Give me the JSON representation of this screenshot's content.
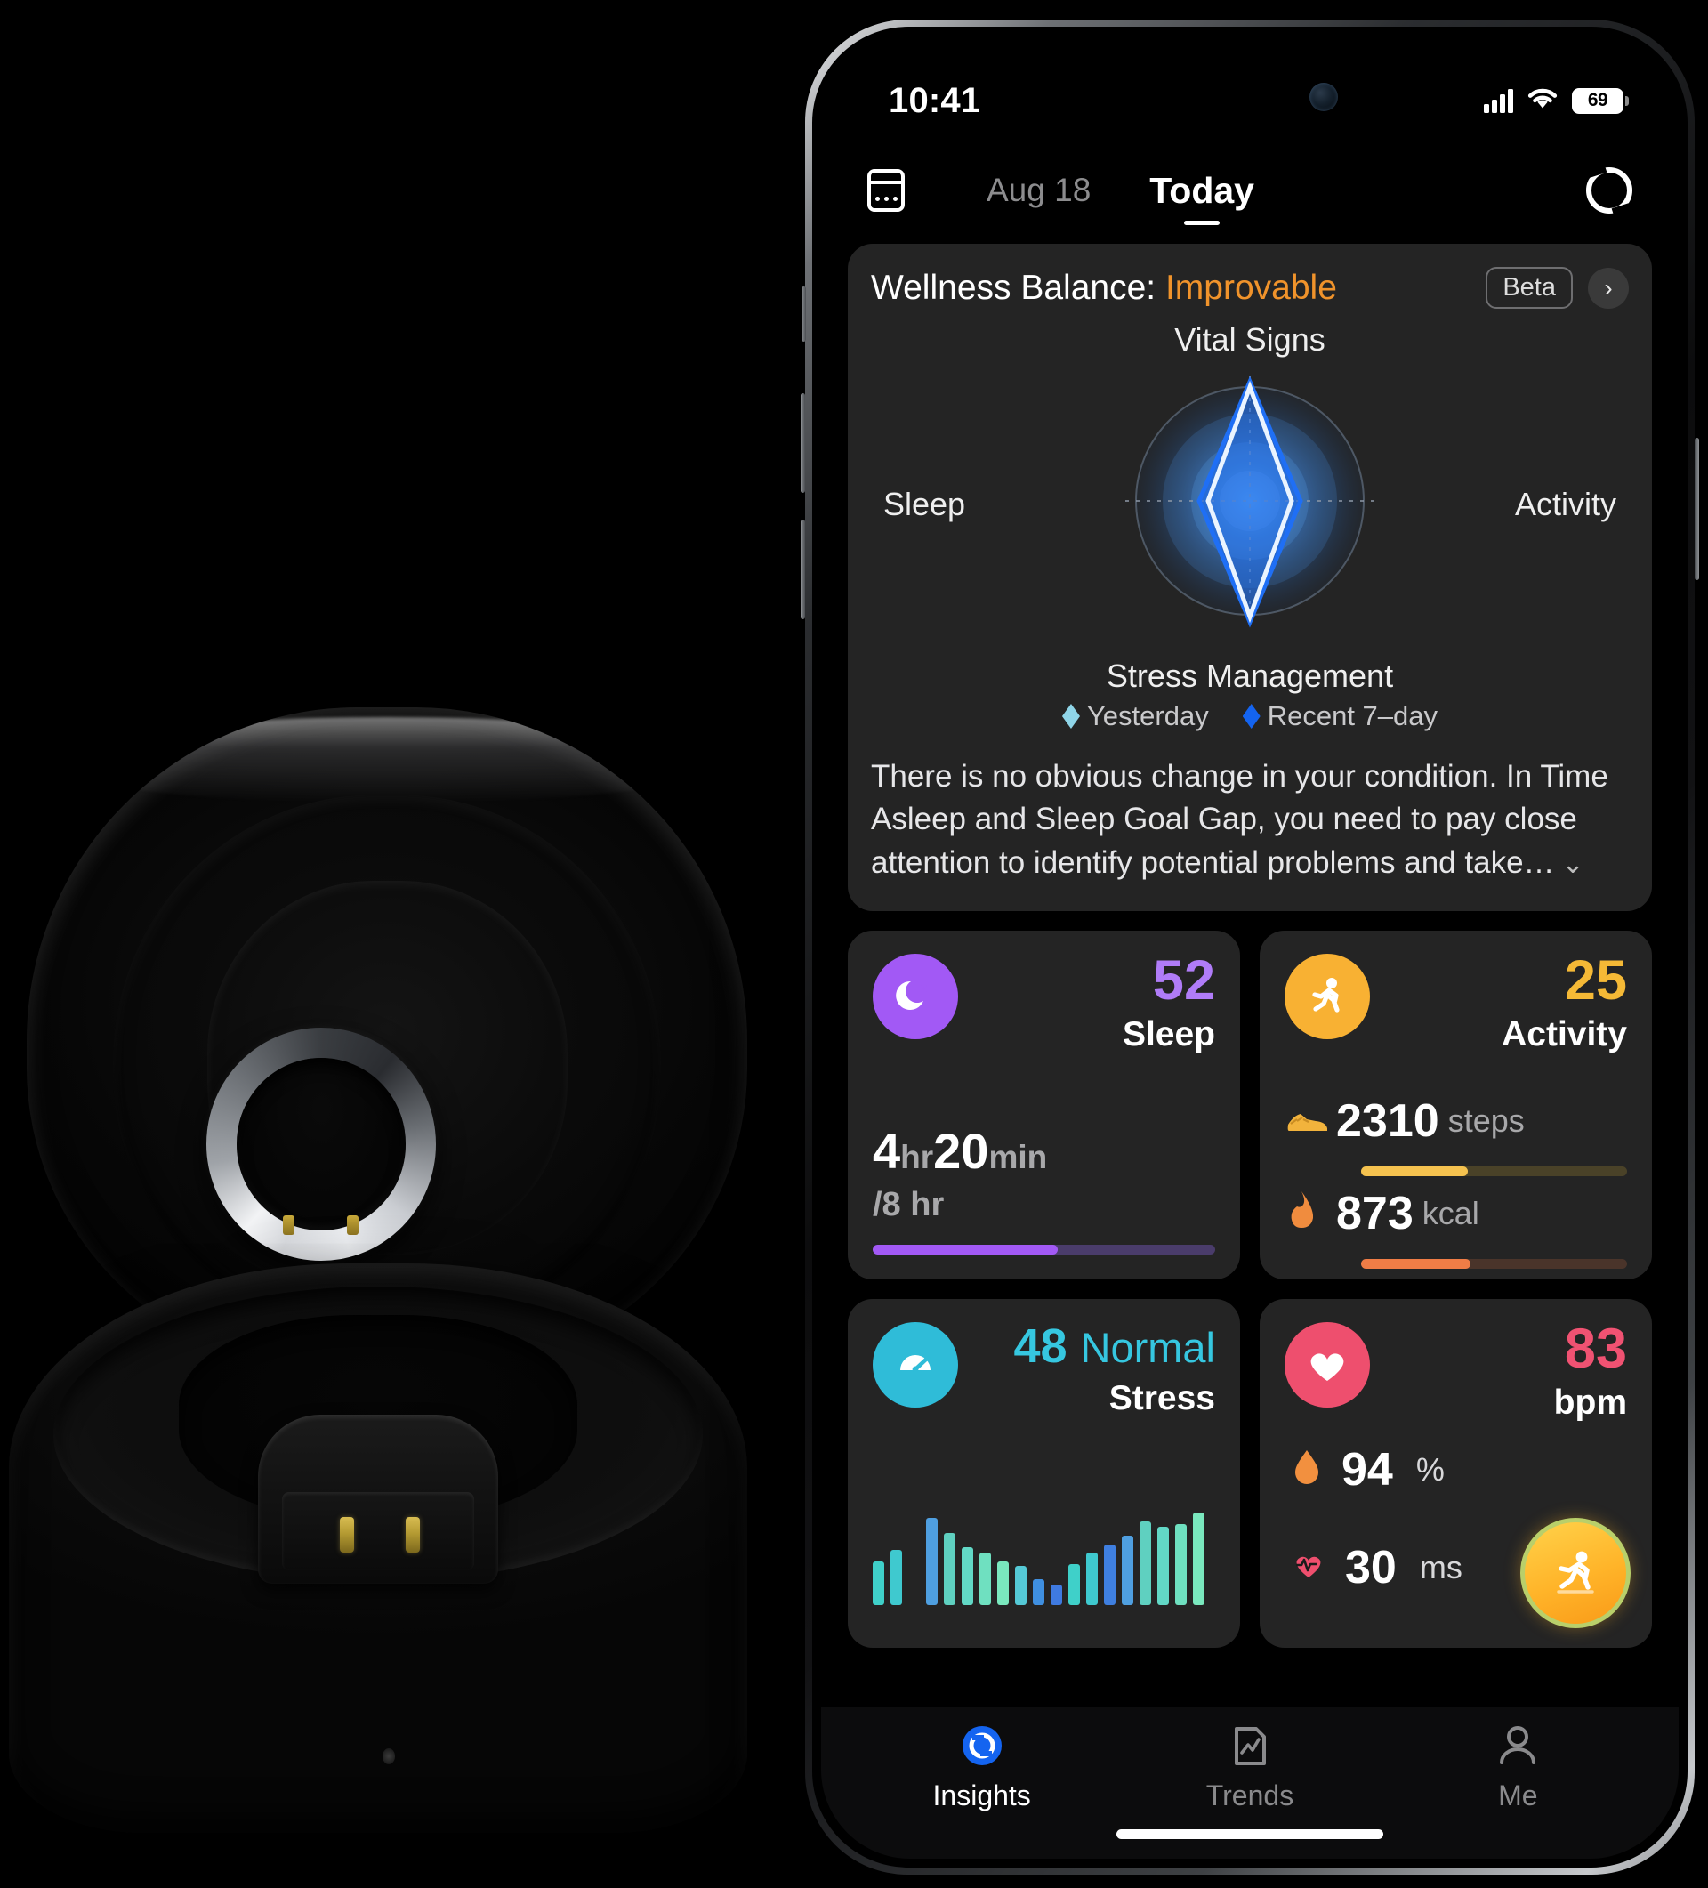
{
  "product": {
    "name": "smart-ring-charging-case",
    "ring_material": "silver-titanium",
    "case_color": "#0a0a0a"
  },
  "phone": {
    "status_bar": {
      "time": "10:41",
      "signal_icon": "cellular-signal-icon",
      "wifi_icon": "wifi-icon",
      "battery_level": "69",
      "battery_icon": "battery-icon"
    },
    "topnav": {
      "calendar_icon": "calendar-icon",
      "date": "Aug 18",
      "today_tab": "Today",
      "sync_icon": "sync-refresh-icon"
    },
    "wellness": {
      "title_prefix": "Wellness Balance:",
      "status": "Improvable",
      "status_color": "#f0932b",
      "beta_label": "Beta",
      "chevron_right": "›",
      "chevron_down": "⌄",
      "description": "There is no obvious change in your condition. In Time Asleep and Sleep Goal Gap, you need to pay close attention to identify potential problems and take…",
      "legend": [
        {
          "label": "Yesterday",
          "color": "#8fd5e8"
        },
        {
          "label": "Recent 7–day",
          "color": "#1464f0"
        }
      ]
    },
    "cards": {
      "sleep": {
        "icon": "sleep-moon-icon",
        "icon_bg": "#a259f5",
        "score": "52",
        "label": "Sleep",
        "score_color": "#b07cf8",
        "hours": "4",
        "hours_unit": "hr",
        "minutes": "20",
        "minutes_unit": "min",
        "goal": "/8 hr",
        "progress_percent": 54,
        "bar_color": "#a259f5"
      },
      "activity": {
        "icon": "running-person-icon",
        "icon_bg": "#f8b133",
        "score": "25",
        "label": "Activity",
        "score_color": "#f5b936",
        "steps_icon": "sneaker-icon",
        "steps_value": "2310",
        "steps_unit": "steps",
        "steps_percent": 40,
        "steps_bar_color": "#f5c24f",
        "kcal_icon": "flame-icon",
        "kcal_value": "873",
        "kcal_unit": "kcal",
        "kcal_percent": 41,
        "kcal_bar_color": "#f07d46"
      },
      "stress": {
        "icon": "stress-gauge-icon",
        "icon_bg": "#2fbcd8",
        "score": "48",
        "state": "Normal",
        "label": "Stress",
        "score_color": "#36c7e0"
      },
      "heart": {
        "icon": "heart-icon",
        "icon_bg": "#ee4f6e",
        "value": "83",
        "unit": "bpm",
        "value_color": "#f05272",
        "spo2_icon": "blood-drop-icon",
        "spo2_value": "94",
        "spo2_unit": "%",
        "hrv_icon": "heart-pulse-icon",
        "hrv_value": "30",
        "hrv_unit": "ms",
        "fab_icon": "workout-run-icon"
      }
    },
    "tabbar": [
      {
        "label": "Insights",
        "icon": "insights-ring-icon",
        "active": true
      },
      {
        "label": "Trends",
        "icon": "trends-chart-icon",
        "active": false
      },
      {
        "label": "Me",
        "icon": "profile-person-icon",
        "active": false
      }
    ]
  },
  "chart_data": [
    {
      "type": "radar",
      "title": "Wellness Balance",
      "axes": [
        "Vital Signs",
        "Activity",
        "Stress Management",
        "Sleep"
      ],
      "axis_labels": {
        "top": "Vital Signs",
        "right": "Activity",
        "bottom": "Stress Management",
        "left": "Sleep"
      },
      "series": [
        {
          "name": "Yesterday",
          "color": "#8fd5e8",
          "values": [
            0.98,
            0.42,
            0.95,
            0.4
          ]
        },
        {
          "name": "Recent 7–day",
          "color": "#1464f0",
          "values": [
            0.86,
            0.52,
            0.84,
            0.5
          ]
        }
      ],
      "range": [
        0,
        1
      ],
      "legend_position": "bottom",
      "grid": "concentric-rings"
    },
    {
      "type": "bar",
      "title": "Stress",
      "ylabel": "",
      "xlabel": "",
      "bar_colors": [
        "#3fd0c9",
        "#3fc9cf",
        "#3f7fe0",
        "#4f9fe0",
        "#5fd0c0",
        "#62d8c6",
        "#6fe0c0",
        "#7ae8be",
        "#55c9d6",
        "#3f8fe0",
        "#3f7ae0"
      ],
      "values": [
        38,
        48,
        0,
        75,
        62,
        50,
        45,
        38,
        34,
        22,
        18,
        35,
        45,
        52,
        60,
        72,
        68,
        70,
        80,
        0,
        0,
        0,
        0,
        0,
        0,
        0,
        0,
        0,
        0,
        0
      ],
      "ylim": [
        0,
        100
      ],
      "grid": false
    }
  ]
}
